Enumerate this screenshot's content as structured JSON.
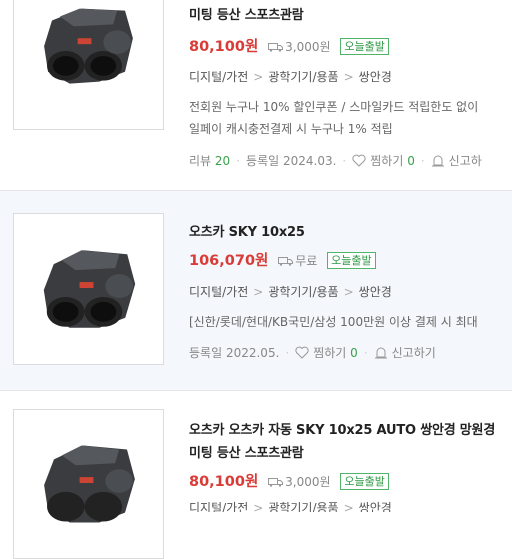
{
  "colors": {
    "price": "#d93b36",
    "badge": "#2f9a45",
    "count": "#3aa14d"
  },
  "items": [
    {
      "title_line2": "미팅 등산 스포츠관람",
      "price": "80,100",
      "won": "원",
      "shipping": "3,000원",
      "badge": "오늘출발",
      "categories": [
        "디지털/가전",
        "광학기기/용품",
        "쌍안경"
      ],
      "desc1": "전회원 누구나 10% 할인쿠폰 / 스마일카드 적립한도 없이",
      "desc2": "일페이 캐시충전결제 시 누구나 1% 적립",
      "review_label": "리뷰",
      "review_count": "20",
      "reg_label": "등록일",
      "reg_date": "2024.03.",
      "wish_label": "찜하기",
      "wish_count": "0",
      "report_label": "신고하"
    },
    {
      "title": "오츠카 SKY 10x25",
      "price": "106,070",
      "won": "원",
      "shipping": "무료",
      "badge": "오늘출발",
      "categories": [
        "디지털/가전",
        "광학기기/용품",
        "쌍안경"
      ],
      "desc1": "[신한/롯데/현대/KB국민/삼성 100만원 이상 결제 시 최대",
      "reg_label": "등록일",
      "reg_date": "2022.05.",
      "wish_label": "찜하기",
      "wish_count": "0",
      "report_label": "신고하기"
    },
    {
      "title": "오츠카 오츠카 자동 SKY 10x25 AUTO 쌍안경 망원경",
      "title_line2": "미팅 등산 스포츠관람",
      "price": "80,100",
      "won": "원",
      "shipping": "3,000원",
      "badge": "오늘출발",
      "categories": [
        "디지털/가전",
        "광학기기/용품",
        "쌍안경"
      ]
    }
  ]
}
